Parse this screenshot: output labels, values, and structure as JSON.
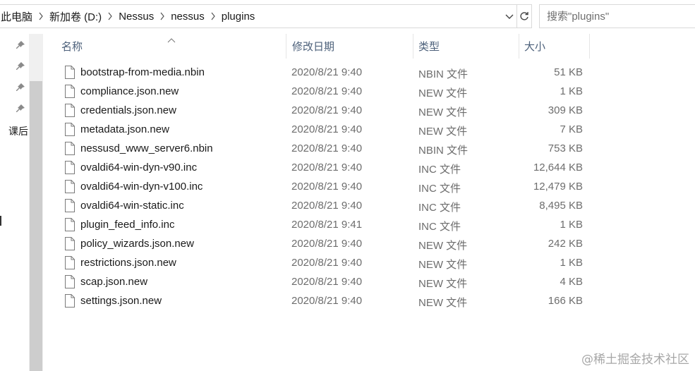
{
  "address_bar": {
    "crumbs": [
      "此电脑",
      "新加卷 (D:)",
      "Nessus",
      "nessus",
      "plugins"
    ]
  },
  "search": {
    "placeholder": "搜索\"plugins\""
  },
  "nav_pane": {
    "label": "课后"
  },
  "columns": {
    "name": "名称",
    "date": "修改日期",
    "type": "类型",
    "size": "大小"
  },
  "files": [
    {
      "name": "bootstrap-from-media.nbin",
      "date": "2020/8/21 9:40",
      "type": "NBIN 文件",
      "size": "51 KB"
    },
    {
      "name": "compliance.json.new",
      "date": "2020/8/21 9:40",
      "type": "NEW 文件",
      "size": "1 KB"
    },
    {
      "name": "credentials.json.new",
      "date": "2020/8/21 9:40",
      "type": "NEW 文件",
      "size": "309 KB"
    },
    {
      "name": "metadata.json.new",
      "date": "2020/8/21 9:40",
      "type": "NEW 文件",
      "size": "7 KB"
    },
    {
      "name": "nessusd_www_server6.nbin",
      "date": "2020/8/21 9:40",
      "type": "NBIN 文件",
      "size": "753 KB"
    },
    {
      "name": "ovaldi64-win-dyn-v90.inc",
      "date": "2020/8/21 9:40",
      "type": "INC 文件",
      "size": "12,644 KB"
    },
    {
      "name": "ovaldi64-win-dyn-v100.inc",
      "date": "2020/8/21 9:40",
      "type": "INC 文件",
      "size": "12,479 KB"
    },
    {
      "name": "ovaldi64-win-static.inc",
      "date": "2020/8/21 9:40",
      "type": "INC 文件",
      "size": "8,495 KB"
    },
    {
      "name": "plugin_feed_info.inc",
      "date": "2020/8/21 9:41",
      "type": "INC 文件",
      "size": "1 KB"
    },
    {
      "name": "policy_wizards.json.new",
      "date": "2020/8/21 9:40",
      "type": "NEW 文件",
      "size": "242 KB"
    },
    {
      "name": "restrictions.json.new",
      "date": "2020/8/21 9:40",
      "type": "NEW 文件",
      "size": "1 KB"
    },
    {
      "name": "scap.json.new",
      "date": "2020/8/21 9:40",
      "type": "NEW 文件",
      "size": "4 KB"
    },
    {
      "name": "settings.json.new",
      "date": "2020/8/21 9:40",
      "type": "NEW 文件",
      "size": "166 KB"
    }
  ],
  "watermark": "@稀土掘金技术社区"
}
